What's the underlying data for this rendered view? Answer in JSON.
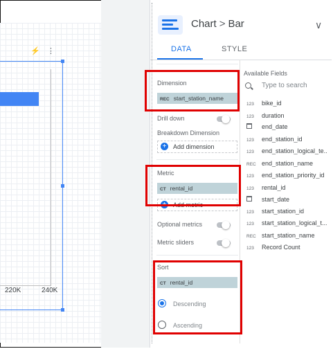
{
  "header": {
    "breadcrumb_root": "Chart",
    "breadcrumb_sep": ">",
    "breadcrumb_leaf": "Bar",
    "chevron": "∨"
  },
  "tabs": [
    {
      "label": "DATA"
    },
    {
      "label": "STYLE"
    }
  ],
  "canvas": {
    "ticks": [
      "220K",
      "240K"
    ],
    "bolt": "⚡",
    "more": "⋮"
  },
  "dimension": {
    "label": "Dimension",
    "chip_type": "REC",
    "chip_value": "start_station_name"
  },
  "drilldown": {
    "label": "Drill down"
  },
  "breakdown": {
    "label": "Breakdown Dimension",
    "add": "Add dimension"
  },
  "metric": {
    "label": "Metric",
    "chip_type": "CT",
    "chip_value": "rental_id",
    "add": "Add metric"
  },
  "optional_metrics": {
    "label": "Optional metrics"
  },
  "metric_sliders": {
    "label": "Metric sliders"
  },
  "sort": {
    "label": "Sort",
    "chip_type": "CT",
    "chip_value": "rental_id",
    "descending": "Descending",
    "ascending": "Ascending"
  },
  "available": {
    "title": "Available Fields",
    "search_placeholder": "Type to search",
    "fields": [
      {
        "icon": "123",
        "name": "bike_id"
      },
      {
        "icon": "123",
        "name": "duration"
      },
      {
        "icon": "calendar-icon",
        "name": "end_date"
      },
      {
        "icon": "123",
        "name": "end_station_id"
      },
      {
        "icon": "123",
        "name": "end_station_logical_te..."
      },
      {
        "icon": "REC",
        "name": "end_station_name"
      },
      {
        "icon": "123",
        "name": "end_station_priority_id"
      },
      {
        "icon": "123",
        "name": "rental_id"
      },
      {
        "icon": "calendar-icon",
        "name": "start_date"
      },
      {
        "icon": "123",
        "name": "start_station_id"
      },
      {
        "icon": "123",
        "name": "start_station_logical_t..."
      },
      {
        "icon": "REC",
        "name": "start_station_name"
      },
      {
        "icon": "123",
        "name": "Record Count"
      }
    ]
  },
  "colors": {
    "accent": "#1a73e8",
    "highlight": "#e00000",
    "chip": "#bfd3d9"
  }
}
